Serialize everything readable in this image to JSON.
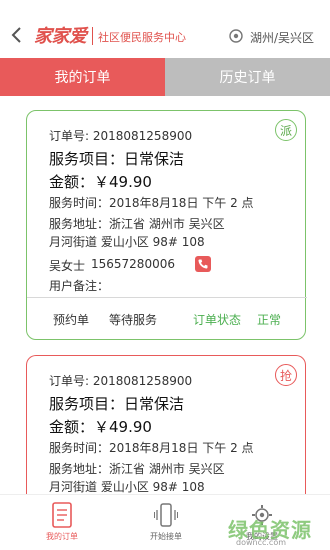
{
  "header": {
    "logo": "家家爱",
    "subtitle": "社区便民服务中心",
    "location": "湖州/吴兴区"
  },
  "tabs": [
    {
      "label": "我的订单",
      "active": true
    },
    {
      "label": "历史订单",
      "active": false
    }
  ],
  "orders": [
    {
      "badge": "派",
      "order_no": "订单号:  2018081258900",
      "service": "服务项目：日常保洁",
      "amount": "金额：￥49.90",
      "time": "服务时间：2018年8月18日  下午 2 点",
      "address_line1": "服务地址：浙江省  湖州市  吴兴区",
      "address_line2": "月河街道  爱山小区  98# 108",
      "customer": "吴女士",
      "phone": "15657280006",
      "remark": "用户备注：",
      "type_label": "预约单",
      "wait_label": "等待服务",
      "status_label": "订单状态",
      "status_value": "正常"
    },
    {
      "badge": "抢",
      "order_no": "订单号:  2018081258900",
      "service": "服务项目：日常保洁",
      "amount": "金额：￥49.90",
      "time": "服务时间：2018年8月18日  下午 2 点",
      "address_line1": "服务地址：浙江省  湖州市  吴兴区",
      "address_line2": "月河街道  爱山小区  98# 108"
    }
  ],
  "bottom_nav": [
    {
      "label": "我的订单",
      "icon": "document-icon",
      "active": true
    },
    {
      "label": "开始接单",
      "icon": "vibrate-phone-icon",
      "active": false
    },
    {
      "label": "我的设置",
      "icon": "gear-icon",
      "active": false
    }
  ],
  "watermark": {
    "text": "绿色资源网",
    "url": "downcc.com"
  },
  "colors": {
    "accent": "#e85a5a",
    "green": "#7cc36a",
    "inactive_tab": "#bdbdbd"
  }
}
